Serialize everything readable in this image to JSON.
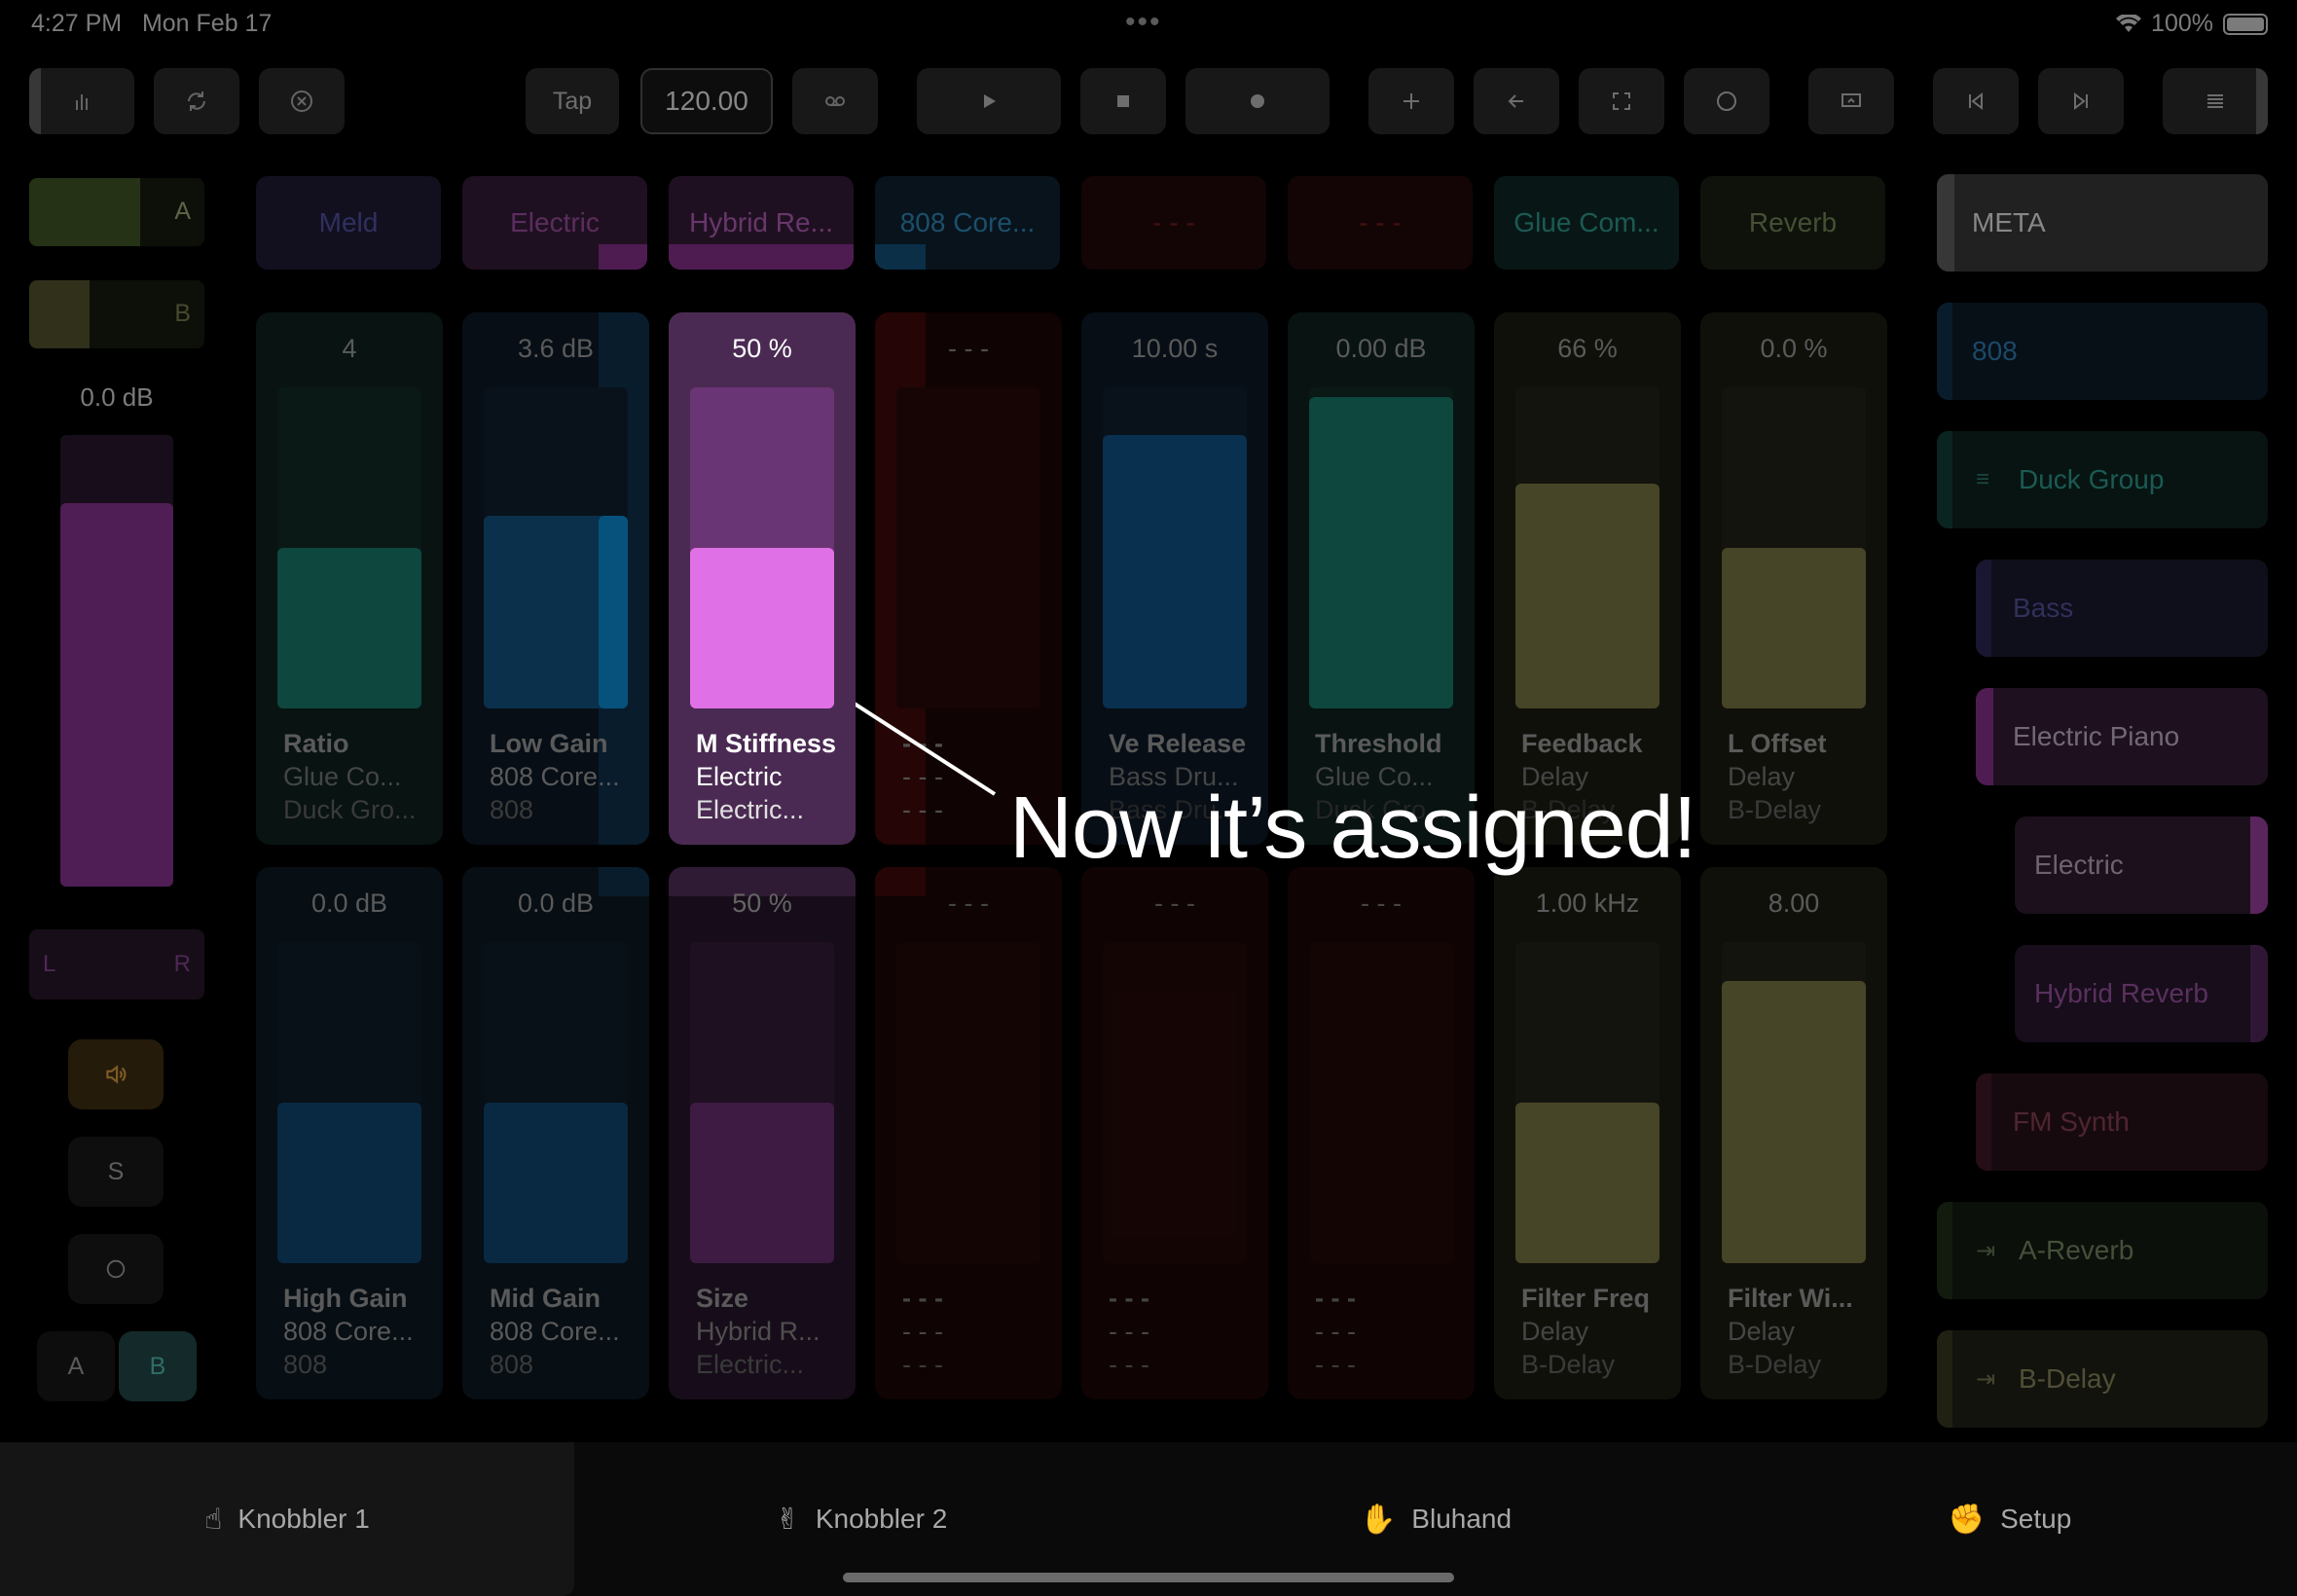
{
  "status_bar": {
    "time": "4:27 PM",
    "date": "Mon Feb 17",
    "battery": "100%"
  },
  "toolbar": {
    "tap": "Tap",
    "tempo": "120.00"
  },
  "left_strip": {
    "slot_a": "A",
    "slot_b": "B",
    "volume": "0.0 dB",
    "pan_left": "L",
    "pan_right": "R",
    "solo": "S",
    "ab_a": "A",
    "ab_b": "B"
  },
  "headers": [
    "Meld",
    "Electric",
    "Hybrid Re...",
    "808 Core...",
    "- - -",
    "- - -",
    "Glue Com...",
    "Reverb"
  ],
  "top_row": [
    {
      "value": "4",
      "name": "Ratio",
      "device": "Glue Co...",
      "track": "Duck Gro..."
    },
    {
      "value": "3.6 dB",
      "name": "Low Gain",
      "device": "808 Core...",
      "track": "808"
    },
    {
      "value": "50 %",
      "name": "M Stiffness",
      "device": "Electric",
      "track": "Electric..."
    },
    {
      "value": "- - -",
      "name": "- - -",
      "device": "- - -",
      "track": "- - -"
    },
    {
      "value": "10.00 s",
      "name": "Ve Release",
      "device": "Bass Dru...",
      "track": "Bass Dru..."
    },
    {
      "value": "0.00 dB",
      "name": "Threshold",
      "device": "Glue Co...",
      "track": "Duck Gro..."
    },
    {
      "value": "66 %",
      "name": "Feedback",
      "device": "Delay",
      "track": "B-Delay"
    },
    {
      "value": "0.0 %",
      "name": "L Offset",
      "device": "Delay",
      "track": "B-Delay"
    }
  ],
  "bottom_row": [
    {
      "value": "0.0 dB",
      "name": "High Gain",
      "device": "808 Core...",
      "track": "808"
    },
    {
      "value": "0.0 dB",
      "name": "Mid Gain",
      "device": "808 Core...",
      "track": "808"
    },
    {
      "value": "50 %",
      "name": "Size",
      "device": "Hybrid R...",
      "track": "Electric..."
    },
    {
      "value": "- - -",
      "name": "- - -",
      "device": "- - -",
      "track": "- - -"
    },
    {
      "value": "- - -",
      "name": "- - -",
      "device": "- - -",
      "track": "- - -"
    },
    {
      "value": "- - -",
      "name": "- - -",
      "device": "- - -",
      "track": "- - -"
    },
    {
      "value": "1.00 kHz",
      "name": "Filter Freq",
      "device": "Delay",
      "track": "B-Delay"
    },
    {
      "value": "8.00",
      "name": "Filter Wi...",
      "device": "Delay",
      "track": "B-Delay"
    }
  ],
  "levels": {
    "top": [
      0.5,
      0.6,
      0.5,
      0,
      0.85,
      0.97,
      0.7,
      0.5
    ],
    "bottom": [
      0.5,
      0.5,
      0.5,
      0,
      0,
      0,
      0.5,
      0.88
    ]
  },
  "tracks": [
    "META",
    "808",
    "Duck Group",
    "Bass",
    "Electric Piano",
    "Electric",
    "Hybrid Reverb",
    "FM Synth",
    "A-Reverb",
    "B-Delay"
  ],
  "overlay_message": "Now it’s assigned!",
  "tabs": [
    "Knobbler 1",
    "Knobbler 2",
    "Bluhand",
    "Setup"
  ]
}
